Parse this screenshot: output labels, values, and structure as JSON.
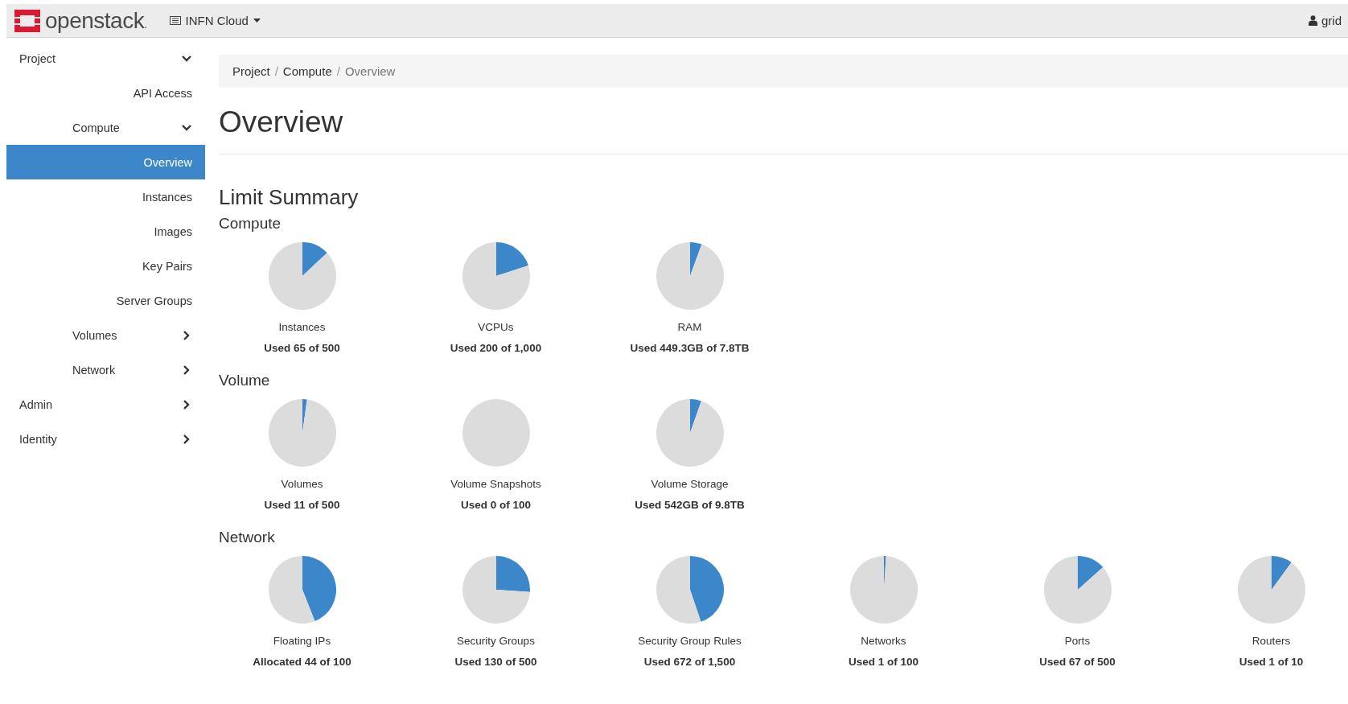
{
  "topbar": {
    "brand": "openstack",
    "brand_suffix": ".",
    "project_menu": "INFN Cloud",
    "user_menu": "grid"
  },
  "sidebar": {
    "items": [
      {
        "label": "Project",
        "expanded": true,
        "children": [
          {
            "label": "API Access",
            "selected": false
          },
          {
            "label": "Compute",
            "expanded": true,
            "children": [
              {
                "label": "Overview",
                "selected": true
              },
              {
                "label": "Instances",
                "selected": false
              },
              {
                "label": "Images",
                "selected": false
              },
              {
                "label": "Key Pairs",
                "selected": false
              },
              {
                "label": "Server Groups",
                "selected": false
              }
            ]
          },
          {
            "label": "Volumes",
            "expanded": false
          },
          {
            "label": "Network",
            "expanded": false
          }
        ]
      },
      {
        "label": "Admin",
        "expanded": false
      },
      {
        "label": "Identity",
        "expanded": false
      }
    ]
  },
  "breadcrumb": [
    {
      "label": "Project",
      "separator": "/"
    },
    {
      "label": "Compute",
      "separator": "/"
    },
    {
      "label": "Overview"
    }
  ],
  "page_title": "Overview",
  "summary_title": "Limit Summary",
  "sections": [
    {
      "title": "Compute",
      "quotas": [
        {
          "name": "Instances",
          "usage": "Used 65 of 500",
          "chart_data": {
            "type": "pie",
            "values": [
              13,
              87
            ]
          }
        },
        {
          "name": "VCPUs",
          "usage": "Used 200 of 1,000",
          "chart_data": {
            "type": "pie",
            "values": [
              20,
              80
            ]
          }
        },
        {
          "name": "RAM",
          "usage": "Used 449.3GB of 7.8TB",
          "chart_data": {
            "type": "pie",
            "values": [
              5.6,
              94.4
            ]
          }
        }
      ]
    },
    {
      "title": "Volume",
      "quotas": [
        {
          "name": "Volumes",
          "usage": "Used 11 of 500",
          "chart_data": {
            "type": "pie",
            "values": [
              2.2,
              97.8
            ]
          }
        },
        {
          "name": "Volume Snapshots",
          "usage": "Used 0 of 100",
          "chart_data": {
            "type": "pie",
            "values": [
              0,
              100
            ]
          }
        },
        {
          "name": "Volume Storage",
          "usage": "Used 542GB of 9.8TB",
          "chart_data": {
            "type": "pie",
            "values": [
              5.4,
              94.6
            ]
          }
        }
      ]
    },
    {
      "title": "Network",
      "quotas": [
        {
          "name": "Floating IPs",
          "usage": "Allocated 44 of 100",
          "chart_data": {
            "type": "pie",
            "values": [
              44,
              56
            ]
          }
        },
        {
          "name": "Security Groups",
          "usage": "Used 130 of 500",
          "chart_data": {
            "type": "pie",
            "values": [
              26,
              74
            ]
          }
        },
        {
          "name": "Security Group Rules",
          "usage": "Used 672 of 1,500",
          "chart_data": {
            "type": "pie",
            "values": [
              44.8,
              55.2
            ]
          }
        },
        {
          "name": "Networks",
          "usage": "Used 1 of 100",
          "chart_data": {
            "type": "pie",
            "values": [
              1,
              99
            ]
          }
        },
        {
          "name": "Ports",
          "usage": "Used 67 of 500",
          "chart_data": {
            "type": "pie",
            "values": [
              13.4,
              86.6
            ]
          }
        },
        {
          "name": "Routers",
          "usage": "Used 1 of 10",
          "chart_data": {
            "type": "pie",
            "values": [
              10,
              90
            ]
          }
        }
      ]
    }
  ]
}
